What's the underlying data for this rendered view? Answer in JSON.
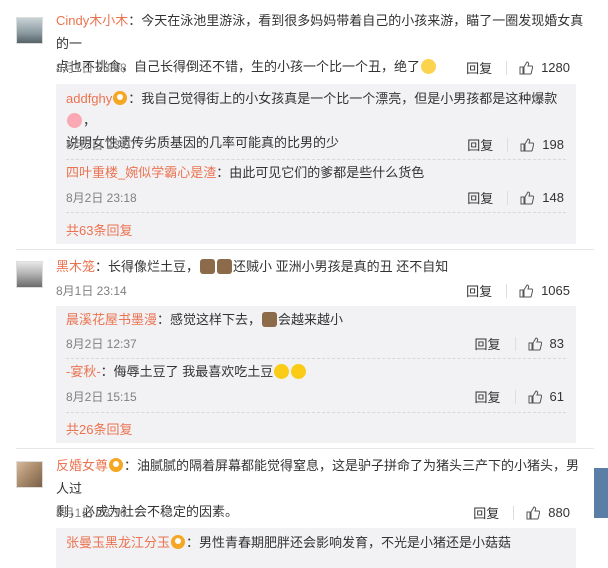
{
  "comments": [
    {
      "user": "Cindy木小木",
      "text1": "：今天在泳池里游泳，看到很多妈妈带着自己的小孩来游，瞄了一圈发现婚女真的一",
      "text2": "点也不挑食，自己长得倒还不错，生的小孩一个比一个丑，绝了",
      "time": "8月1日 23:08",
      "reply": "回复",
      "likes": "1280",
      "replies": [
        {
          "user": "addfghy",
          "text1": "：我自己觉得街上的小女孩真是一个比一个漂亮，但是小男孩都是这种爆款",
          "text2": "说明女性遗传劣质基因的几率可能真的比男的少",
          "time": "8月2日 23:07",
          "reply": "回复",
          "likes": "198"
        },
        {
          "user": "四叶重楼_婉似学霸心是渣",
          "text1": "：由此可见它们的爹都是些什么货色",
          "time": "8月2日 23:18",
          "reply": "回复",
          "likes": "148"
        }
      ],
      "more": "共63条回复"
    },
    {
      "user": "黑木笼",
      "text1": "：长得像烂土豆，",
      "text1b": "还贼小  亚洲小男孩是真的丑 还不自知",
      "time": "8月1日 23:14",
      "reply": "回复",
      "likes": "1065",
      "replies": [
        {
          "user": "晨溪花屋书墨漫",
          "text1": "：感觉这样下去，",
          "text1b": "会越来越小",
          "time": "8月2日 12:37",
          "reply": "回复",
          "likes": "83"
        },
        {
          "user": "-宴秋-",
          "text1": "：侮辱土豆了 我最喜欢吃土豆",
          "time": "8月2日 15:15",
          "reply": "回复",
          "likes": "61"
        }
      ],
      "more": "共26条回复"
    },
    {
      "user": "反婚女尊",
      "text1": "：油腻腻的隔着屏幕都能觉得窒息，这是驴子拼命了为猪头三产下的小猪头，男人过",
      "text2": "剩，必成为社会不稳定的因素。",
      "time": "8月1日 23:10",
      "reply": "回复",
      "likes": "880",
      "replies": [
        {
          "user": "张曼玉黑龙江分玉",
          "text1": "：男性青春期肥胖还会影响发育，不光是小猪还是小菇菇"
        }
      ]
    }
  ]
}
